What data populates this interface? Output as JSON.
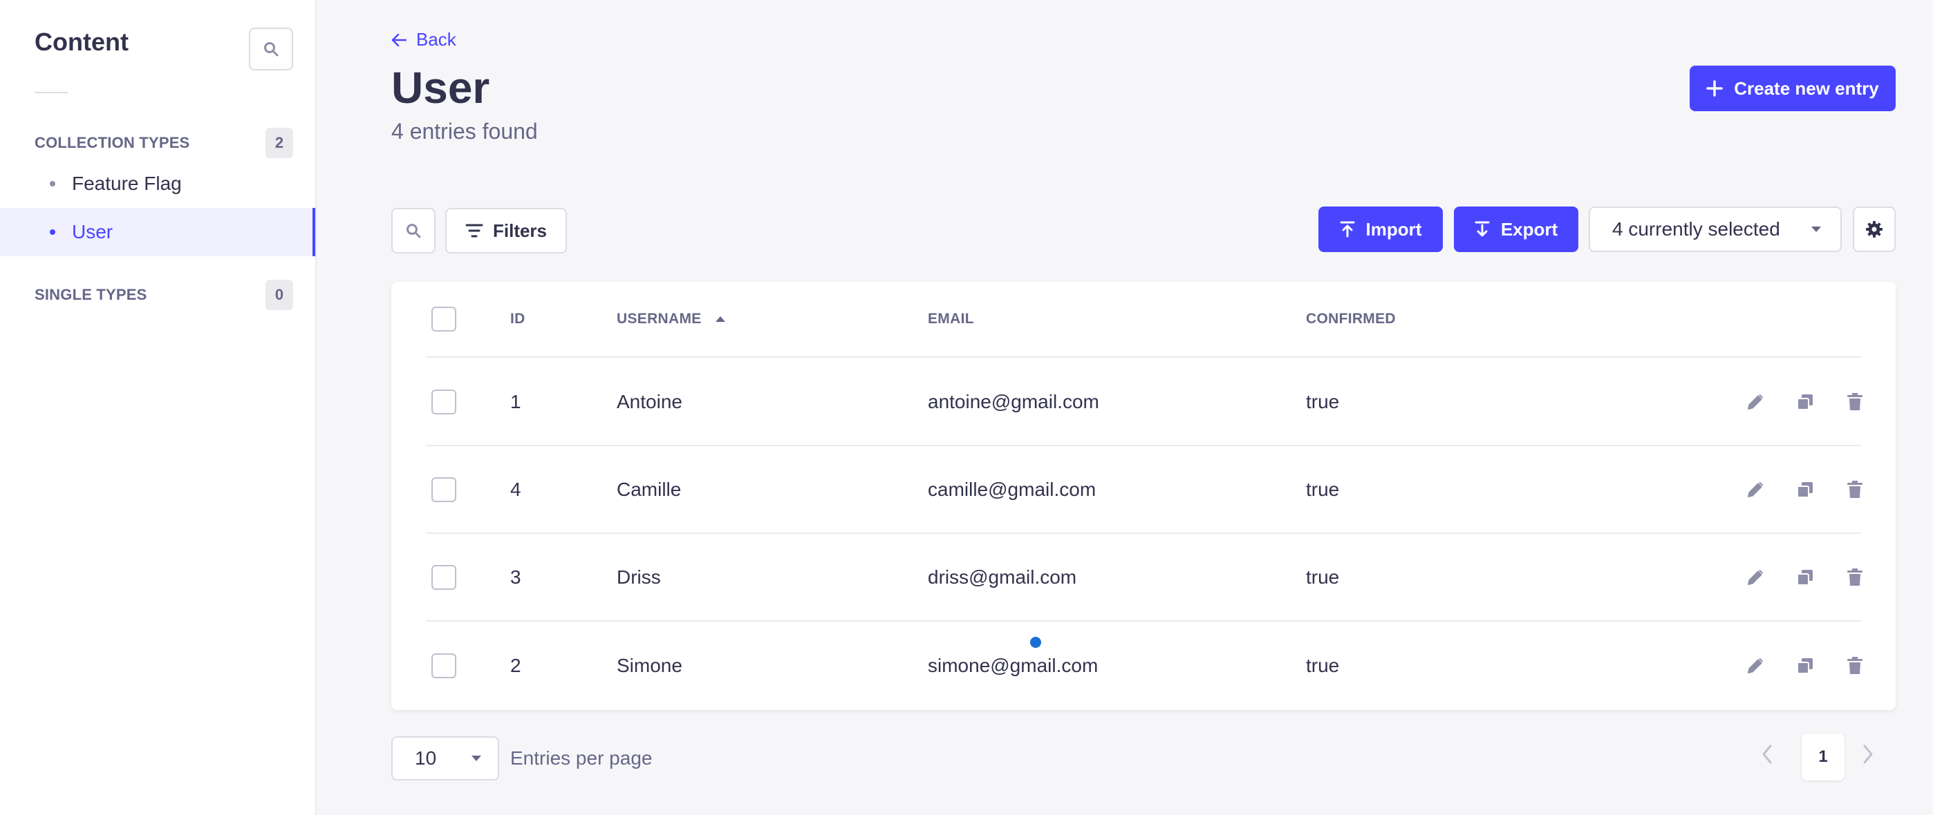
{
  "sidebar": {
    "title": "Content",
    "collection_types": {
      "label": "COLLECTION TYPES",
      "count": "2",
      "items": [
        {
          "label": "Feature Flag",
          "active": false
        },
        {
          "label": "User",
          "active": true
        }
      ]
    },
    "single_types": {
      "label": "SINGLE TYPES",
      "count": "0"
    }
  },
  "header": {
    "back_label": "Back",
    "title": "User",
    "subtitle": "4 entries found",
    "create_label": "Create new entry"
  },
  "toolbar": {
    "filters_label": "Filters",
    "import_label": "Import",
    "export_label": "Export",
    "columns_selected": "4 currently selected"
  },
  "table": {
    "columns": [
      "ID",
      "USERNAME",
      "EMAIL",
      "CONFIRMED"
    ],
    "sorted_column": "USERNAME",
    "sort_direction": "ascending",
    "rows": [
      {
        "id": "1",
        "username": "Antoine",
        "email": "antoine@gmail.com",
        "confirmed": "true"
      },
      {
        "id": "4",
        "username": "Camille",
        "email": "camille@gmail.com",
        "confirmed": "true"
      },
      {
        "id": "3",
        "username": "Driss",
        "email": "driss@gmail.com",
        "confirmed": "true"
      },
      {
        "id": "2",
        "username": "Simone",
        "email": "simone@gmail.com",
        "confirmed": "true"
      }
    ]
  },
  "footer": {
    "per_page_value": "10",
    "per_page_label": "Entries per page",
    "current_page": "1"
  },
  "colors": {
    "primary": "#4945ff",
    "text": "#32324d",
    "muted": "#666687",
    "background": "#f6f6f9"
  }
}
